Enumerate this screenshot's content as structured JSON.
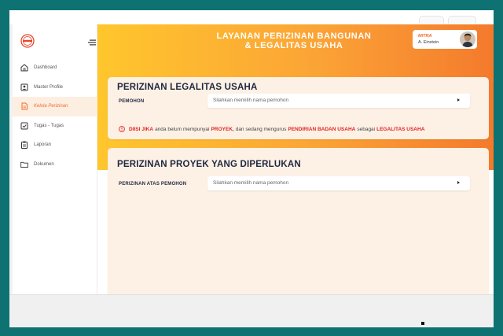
{
  "header": {
    "title_line1": "LAYANAN PERIZINAN BANGUNAN",
    "title_line2": "& LEGALITAS USAHA"
  },
  "user": {
    "role": "MITRA",
    "name": "A. Einstein"
  },
  "sidebar": {
    "items": [
      {
        "label": "Dashboard",
        "icon": "home-icon",
        "active": false
      },
      {
        "label": "Master Profile",
        "icon": "profile-icon",
        "active": false
      },
      {
        "label": "Kelola Perizinan",
        "icon": "document-icon",
        "active": true
      },
      {
        "label": "Tugas - Tugas",
        "icon": "checkbox-icon",
        "active": false
      },
      {
        "label": "Laporan",
        "icon": "report-icon",
        "active": false
      },
      {
        "label": "Dokumen",
        "icon": "folder-icon",
        "active": false
      }
    ]
  },
  "legalitas": {
    "title": "PERIZINAN LEGALITAS USAHA",
    "field_label": "PEMOHON",
    "placeholder": "Silahkan memilih nama pemohon",
    "notice": {
      "part1": "DIISI JIKA",
      "part2": "anda belum mempunyai",
      "part3": "PROYEK,",
      "part4": "dan sedang mengurus",
      "part5": "PENDIRIAN BADAN USAHA",
      "part6": "sebagai",
      "part7": "LEGALITAS USAHA"
    }
  },
  "proyek": {
    "title": "PERIZINAN PROYEK YANG DIPERLUKAN",
    "field_label": "PERIZINAN ATAS PEMOHON",
    "placeholder": "Silahkan memilih nama pemohon"
  },
  "colors": {
    "accent": "#f26b2a",
    "gradient_start": "#ffc62d",
    "gradient_end": "#f47a2c",
    "warning": "#e02424",
    "frame": "#0f7272"
  }
}
